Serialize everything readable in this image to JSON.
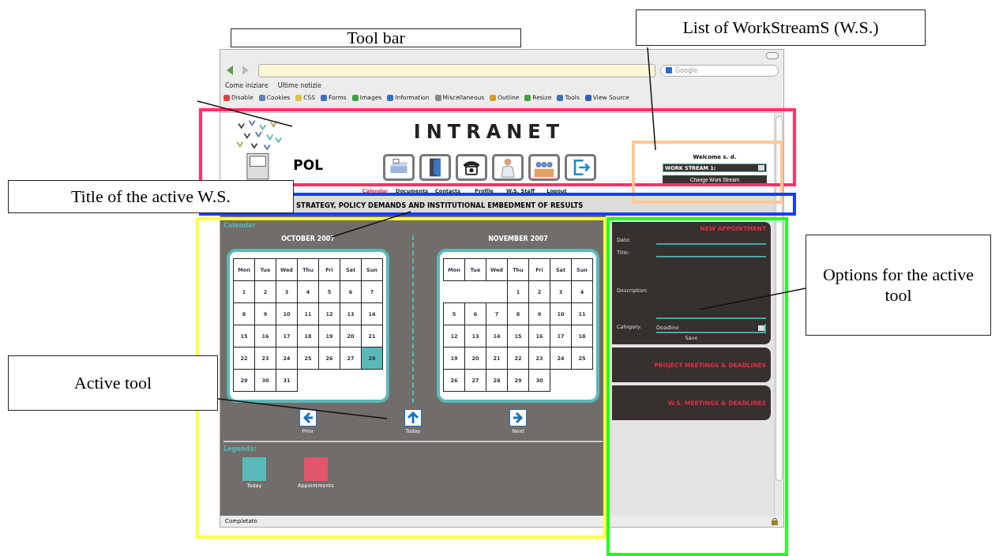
{
  "annotations": [
    {
      "kind": "toolbar",
      "text": "Tool bar"
    },
    {
      "kind": "workstreams",
      "text": "List of WorkStreamS (W.S.)"
    },
    {
      "kind": "title",
      "text": "Title of the active W.S."
    },
    {
      "kind": "options",
      "text": "Options for the active tool"
    },
    {
      "kind": "tool",
      "text": "Active tool"
    }
  ],
  "browser": {
    "search_placeholder": "Google",
    "bookmarks": [
      "Come iniziare",
      "Ultime notizie"
    ],
    "devtools": [
      "Disable",
      "Cookies",
      "CSS",
      "Forms",
      "Images",
      "Information",
      "Miscellaneous",
      "Outline",
      "Resize",
      "Tools",
      "View Source"
    ],
    "status": "Completato"
  },
  "header": {
    "title": "INTRANET",
    "logo_text": "POL",
    "welcome": "Welcome s. d.",
    "workstream": "WORK STREAM 1:",
    "change_button": "Change Work Stream"
  },
  "nav": [
    {
      "label": "Calendar",
      "kind": "scanner",
      "selected": true
    },
    {
      "label": "Documents",
      "kind": "door",
      "selected": false
    },
    {
      "label": "Contacts",
      "kind": "phone",
      "selected": false
    },
    {
      "label": "Profile",
      "kind": "person",
      "selected": false
    },
    {
      "label": "W.S. Staff",
      "kind": "group",
      "selected": false
    },
    {
      "label": "Logout",
      "kind": "logout",
      "selected": false
    }
  ],
  "ws_title": "STRATEGY, POLICY DEMANDS AND INSTITUTIONAL EMBEDMENT OF RESULTS",
  "calendar": {
    "heading": "Calendar",
    "months": [
      {
        "title": "OCTOBER 2007",
        "weekdays": [
          "Mon",
          "Tue",
          "Wed",
          "Thu",
          "Fri",
          "Sat",
          "Sun"
        ],
        "weeks": [
          [
            {
              "kind": "day",
              "d": "1",
              "today": false
            },
            {
              "kind": "day",
              "d": "2",
              "today": false
            },
            {
              "kind": "day",
              "d": "3",
              "today": false
            },
            {
              "kind": "day",
              "d": "4",
              "today": false
            },
            {
              "kind": "day",
              "d": "5",
              "today": false
            },
            {
              "kind": "day",
              "d": "6",
              "today": false
            },
            {
              "kind": "day",
              "d": "7",
              "today": false
            }
          ],
          [
            {
              "kind": "day",
              "d": "8",
              "today": false
            },
            {
              "kind": "day",
              "d": "9",
              "today": false
            },
            {
              "kind": "day",
              "d": "10",
              "today": false
            },
            {
              "kind": "day",
              "d": "11",
              "today": false
            },
            {
              "kind": "day",
              "d": "12",
              "today": false
            },
            {
              "kind": "day",
              "d": "13",
              "today": false
            },
            {
              "kind": "day",
              "d": "14",
              "today": false
            }
          ],
          [
            {
              "kind": "day",
              "d": "15",
              "today": false
            },
            {
              "kind": "day",
              "d": "16",
              "today": false
            },
            {
              "kind": "day",
              "d": "17",
              "today": false
            },
            {
              "kind": "day",
              "d": "18",
              "today": false
            },
            {
              "kind": "day",
              "d": "19",
              "today": false
            },
            {
              "kind": "day",
              "d": "20",
              "today": false
            },
            {
              "kind": "day",
              "d": "21",
              "today": false
            }
          ],
          [
            {
              "kind": "day",
              "d": "22",
              "today": false
            },
            {
              "kind": "day",
              "d": "23",
              "today": false
            },
            {
              "kind": "day",
              "d": "24",
              "today": false
            },
            {
              "kind": "day",
              "d": "25",
              "today": false
            },
            {
              "kind": "day",
              "d": "26",
              "today": false
            },
            {
              "kind": "day",
              "d": "27",
              "today": false
            },
            {
              "kind": "day",
              "d": "28",
              "today": true
            }
          ],
          [
            {
              "kind": "day",
              "d": "29",
              "today": false
            },
            {
              "kind": "day",
              "d": "30",
              "today": false
            },
            {
              "kind": "day",
              "d": "31",
              "today": false
            },
            {
              "kind": "empty"
            },
            {
              "kind": "empty"
            },
            {
              "kind": "empty"
            },
            {
              "kind": "empty"
            }
          ]
        ]
      },
      {
        "title": "NOVEMBER 2007",
        "weekdays": [
          "Mon",
          "Tue",
          "Wed",
          "Thu",
          "Fri",
          "Sat",
          "Sun"
        ],
        "weeks": [
          [
            {
              "kind": "empty"
            },
            {
              "kind": "empty"
            },
            {
              "kind": "empty"
            },
            {
              "kind": "day",
              "d": "1",
              "today": false
            },
            {
              "kind": "day",
              "d": "2",
              "today": false
            },
            {
              "kind": "day",
              "d": "3",
              "today": false
            },
            {
              "kind": "day",
              "d": "4",
              "today": false
            }
          ],
          [
            {
              "kind": "day",
              "d": "5",
              "today": false
            },
            {
              "kind": "day",
              "d": "6",
              "today": false
            },
            {
              "kind": "day",
              "d": "7",
              "today": false
            },
            {
              "kind": "day",
              "d": "8",
              "today": false
            },
            {
              "kind": "day",
              "d": "9",
              "today": false
            },
            {
              "kind": "day",
              "d": "10",
              "today": false
            },
            {
              "kind": "day",
              "d": "11",
              "today": false
            }
          ],
          [
            {
              "kind": "day",
              "d": "12",
              "today": false
            },
            {
              "kind": "day",
              "d": "13",
              "today": false
            },
            {
              "kind": "day",
              "d": "14",
              "today": false
            },
            {
              "kind": "day",
              "d": "15",
              "today": false
            },
            {
              "kind": "day",
              "d": "16",
              "today": false
            },
            {
              "kind": "day",
              "d": "17",
              "today": false
            },
            {
              "kind": "day",
              "d": "18",
              "today": false
            }
          ],
          [
            {
              "kind": "day",
              "d": "19",
              "today": false
            },
            {
              "kind": "day",
              "d": "20",
              "today": false
            },
            {
              "kind": "day",
              "d": "21",
              "today": false
            },
            {
              "kind": "day",
              "d": "22",
              "today": false
            },
            {
              "kind": "day",
              "d": "23",
              "today": false
            },
            {
              "kind": "day",
              "d": "24",
              "today": false
            },
            {
              "kind": "day",
              "d": "25",
              "today": false
            }
          ],
          [
            {
              "kind": "day",
              "d": "26",
              "today": false
            },
            {
              "kind": "day",
              "d": "27",
              "today": false
            },
            {
              "kind": "day",
              "d": "28",
              "today": false
            },
            {
              "kind": "day",
              "d": "29",
              "today": false
            },
            {
              "kind": "day",
              "d": "30",
              "today": false
            },
            {
              "kind": "empty"
            },
            {
              "kind": "empty"
            }
          ]
        ]
      }
    ],
    "pager": [
      {
        "kind": "prev",
        "label": "Prev"
      },
      {
        "kind": "today",
        "label": "Today"
      },
      {
        "kind": "next",
        "label": "Next"
      }
    ],
    "legend_title": "Legenda:",
    "legend": [
      {
        "label": "Today",
        "color": "#5bb8b8"
      },
      {
        "label": "Appointments",
        "color": "#e0566b"
      }
    ]
  },
  "appointment": {
    "title": "NEW APPOINTMENT",
    "date_label": "Date:",
    "title_label": "Title:",
    "description_label": "Description:",
    "category_label": "Category:",
    "category": "Deadline",
    "save": "Save"
  },
  "sections": [
    "PROJECT MEETINGS & DEADLINES",
    "W.S. MEETINGS & DEADLINES"
  ]
}
